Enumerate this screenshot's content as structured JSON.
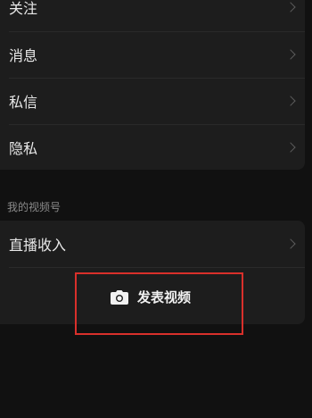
{
  "settings": {
    "items": [
      {
        "label": "关注"
      },
      {
        "label": "消息"
      },
      {
        "label": "私信"
      },
      {
        "label": "隐私"
      }
    ]
  },
  "channel_section": {
    "title": "我的视频号",
    "income_label": "直播收入",
    "post_button_label": "发表视频",
    "post_icon": "camera-icon"
  },
  "colors": {
    "background": "#111111",
    "card": "#1d1d1d",
    "highlight_border": "#d9302b"
  }
}
